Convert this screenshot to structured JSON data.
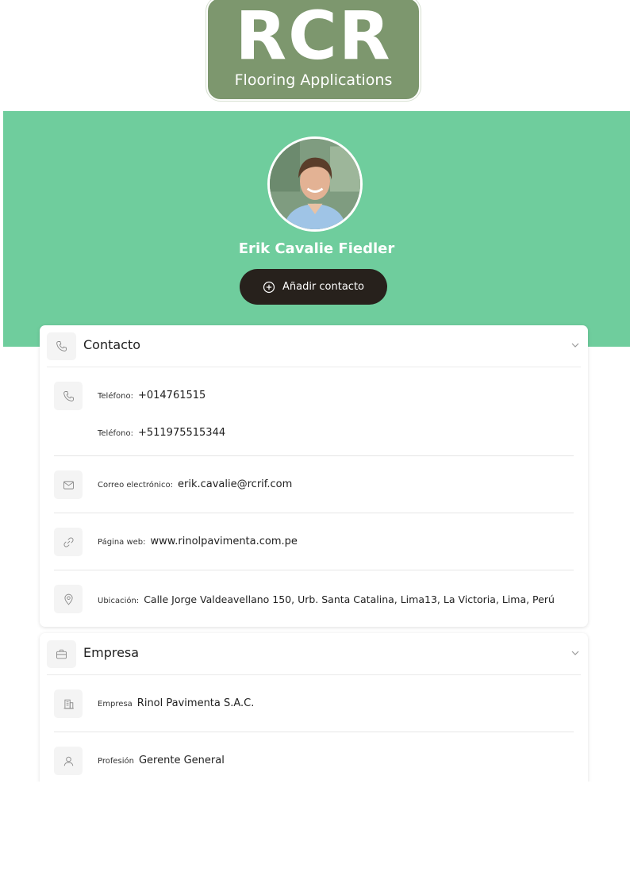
{
  "logo": {
    "main_text": "RCR",
    "sub_text": "Flooring Applications"
  },
  "profile": {
    "name": "Erik Cavalie Fiedler",
    "add_contact_label": "Añadir contacto"
  },
  "contact_section": {
    "title": "Contacto",
    "phones": [
      {
        "label": "Teléfono:",
        "value": "+014761515"
      },
      {
        "label": "Teléfono:",
        "value": "+511975515344"
      }
    ],
    "email": {
      "label": "Correo electrónico:",
      "value": "erik.cavalie@rcrif.com"
    },
    "website": {
      "label": "Página web:",
      "value": "www.rinolpavimenta.com.pe"
    },
    "location": {
      "label": "Ubicación:",
      "value": "Calle Jorge Valdeavellano 150, Urb. Santa Catalina, Lima13, La Victoria, Lima, Perú"
    }
  },
  "company_section": {
    "title": "Empresa",
    "company": {
      "label": "Empresa",
      "value": "Rinol Pavimenta S.A.C."
    },
    "profession": {
      "label": "Profesión",
      "value": "Gerente General"
    }
  },
  "colors": {
    "hero_green": "#6fcd9d",
    "logo_green": "#7d976e",
    "button_dark": "#27211c"
  },
  "icons": [
    "phone-icon",
    "mail-icon",
    "link-icon",
    "location-pin-icon",
    "briefcase-icon",
    "building-icon",
    "user-icon",
    "chevron-down-icon",
    "plus-circle-icon"
  ]
}
